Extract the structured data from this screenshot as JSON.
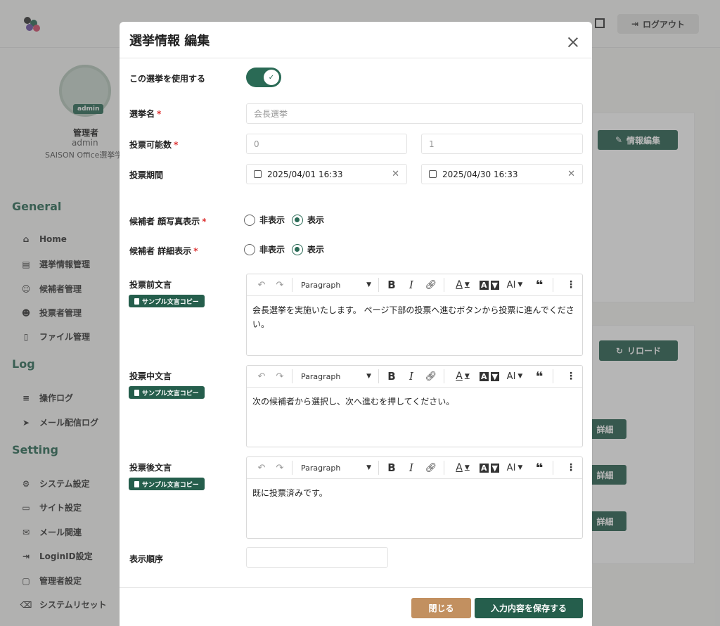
{
  "header": {
    "logout_label": "ログアウト"
  },
  "sidebar": {
    "avatar_badge": "admin",
    "user_role": "管理者",
    "user_id": "admin",
    "user_org": "SAISON Office選挙学",
    "sections": {
      "general": "General",
      "log": "Log",
      "setting": "Setting"
    },
    "items": [
      {
        "label": "Home",
        "icon": "home-icon"
      },
      {
        "label": "選挙情報管理",
        "icon": "archive-icon"
      },
      {
        "label": "候補者管理",
        "icon": "user-check-icon"
      },
      {
        "label": "投票者管理",
        "icon": "users-icon"
      },
      {
        "label": "ファイル管理",
        "icon": "file-icon"
      },
      {
        "label": "操作ログ",
        "icon": "database-icon"
      },
      {
        "label": "メール配信ログ",
        "icon": "send-icon"
      },
      {
        "label": "システム設定",
        "icon": "gear-icon"
      },
      {
        "label": "サイト設定",
        "icon": "monitor-icon"
      },
      {
        "label": "メール関連",
        "icon": "mail-icon"
      },
      {
        "label": "LoginID設定",
        "icon": "login-icon"
      },
      {
        "label": "管理者設定",
        "icon": "clipboard-icon"
      },
      {
        "label": "システムリセット",
        "icon": "delete-icon"
      }
    ]
  },
  "background": {
    "edit_info_label": "情報編集",
    "reload_label": "リロード",
    "detail_label": "詳細"
  },
  "modal": {
    "title": "選挙情報 編集",
    "use_election_label": "この選挙を使用する",
    "use_election_on": true,
    "election_name_label": "選挙名",
    "election_name_placeholder": "会長選挙",
    "vote_count_label": "投票可能数",
    "vote_min_placeholder": "0",
    "vote_max_placeholder": "1",
    "period_label": "投票期間",
    "period_start": "2025/04/01 16:33",
    "period_end": "2025/04/30 16:33",
    "photo_label": "候補者 顔写真表示",
    "detail_label": "候補者 詳細表示",
    "radio_hide": "非表示",
    "radio_show": "表示",
    "copy_button": "サンプル文言コピー",
    "paragraph": "Paragraph",
    "before_label": "投票前文言",
    "before_text": "会長選挙を実施いたします。 ページ下部の投票へ進むボタンから投票に進んでください。",
    "during_label": "投票中文言",
    "during_text": "次の候補者から選択し、次へ進むを押してください。",
    "after_label": "投票後文言",
    "after_text": "既に投票済みです。",
    "order_label": "表示順序",
    "close_button": "閉じる",
    "save_button": "入力内容を保存する"
  },
  "colors": {
    "primary": "#255e4c",
    "accent": "#c29060",
    "required": "#dd3333"
  }
}
